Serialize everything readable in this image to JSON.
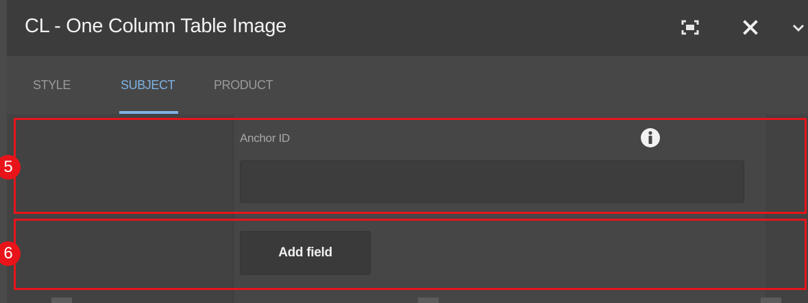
{
  "dialog": {
    "title": "CL - One Column Table Image",
    "icons": {
      "fullscreen": "fullscreen-icon",
      "close": "close-icon",
      "chevron": "chevron-down-icon"
    }
  },
  "tabs": [
    {
      "label": "STYLE",
      "active": false
    },
    {
      "label": "SUBJECT",
      "active": true
    },
    {
      "label": "PRODUCT",
      "active": false
    }
  ],
  "fields": {
    "anchor_id": {
      "label": "Anchor ID",
      "value": "",
      "placeholder": "",
      "info_icon": "info-icon"
    },
    "add_field_label": "Add field"
  },
  "annotations": [
    {
      "number": "5",
      "target": "anchor-id-field"
    },
    {
      "number": "6",
      "target": "add-field-button"
    }
  ],
  "colors": {
    "accent": "#7fb2e5",
    "annotation_red": "#e8141a",
    "titlebar": "#3c3c3c",
    "background": "#474747"
  }
}
